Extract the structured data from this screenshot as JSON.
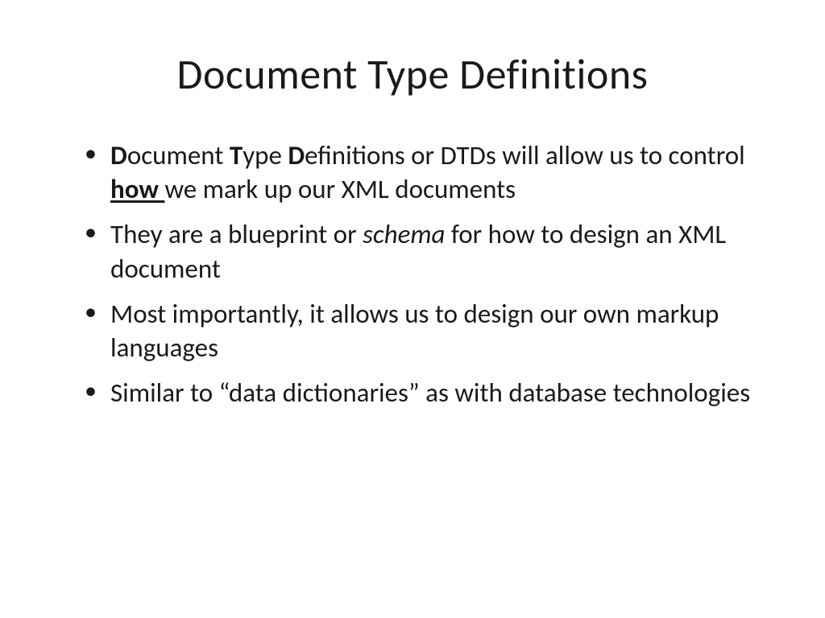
{
  "title": "Document Type Definitions",
  "bullets": {
    "b1": {
      "p1_bold": "D",
      "p2": "ocument ",
      "p3_bold": "T",
      "p4": "ype ",
      "p5_bold": "D",
      "p6": "efinitions or DTDs will allow us to control ",
      "p7_bold_underline": "how ",
      "p8": "we mark up our XML documents"
    },
    "b2": {
      "p1": "They are a blueprint or ",
      "p2_italic": "schema",
      "p3": " for how to design an XML document"
    },
    "b3": "Most importantly, it allows us to design our own markup languages",
    "b4": "Similar to “data dictionaries” as with database technologies"
  }
}
